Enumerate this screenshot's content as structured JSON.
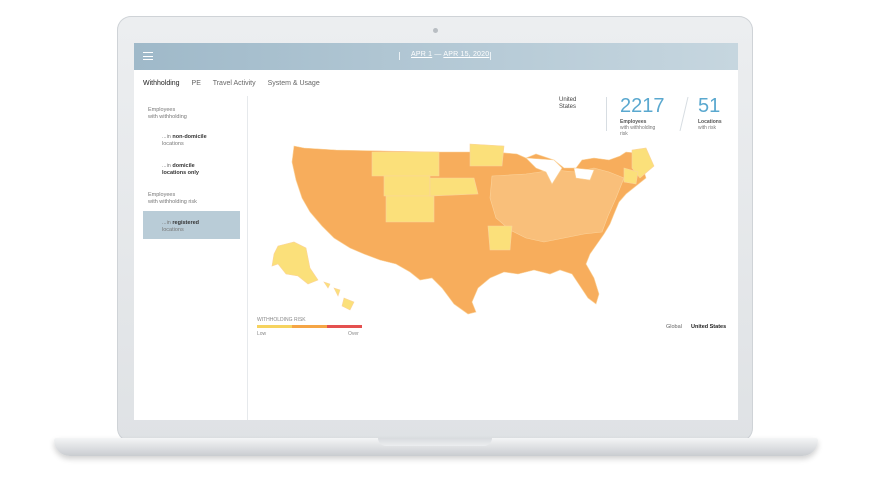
{
  "header": {
    "menu_icon": "hamburger-icon",
    "date_start": "APR 1",
    "date_sep": " — ",
    "date_end": "APR 15, 2020"
  },
  "tabs": [
    {
      "label": "Withholding"
    },
    {
      "label": "PE"
    },
    {
      "label": "Travel Activity"
    },
    {
      "label": "System & Usage"
    }
  ],
  "sidebar": {
    "employees_with_withholding": [
      "Employees",
      "with withholding"
    ],
    "non_domicile": {
      "prefix": "...in ",
      "bold1": "non-domicile",
      "line2": "locations"
    },
    "domicile": {
      "prefix": "...in ",
      "bold1": "domicile",
      "line2": "locations only"
    },
    "employees_with_risk": [
      "Employees",
      "with withholding risk"
    ],
    "registered": {
      "prefix": "...in ",
      "bold1": "registered",
      "line2": "locations"
    }
  },
  "summary": {
    "country": [
      "United",
      "States"
    ],
    "employees": {
      "value": "2217",
      "label1": "Employees",
      "label2": "with withholding",
      "label3": "risk"
    },
    "locations": {
      "value": "51",
      "label1": "Locations",
      "label2": "with risk"
    }
  },
  "legend": {
    "title": "WITHHOLDING RISK",
    "low": "Low",
    "over": "Over",
    "colors": [
      "#f6d35f",
      "#f5a545",
      "#e4504f"
    ]
  },
  "scope": {
    "global": "Global",
    "us": "United States"
  },
  "map_colors": {
    "orange": "#f7ad5c",
    "light_orange": "#f9bf7a",
    "yellow": "#fbe07a"
  }
}
